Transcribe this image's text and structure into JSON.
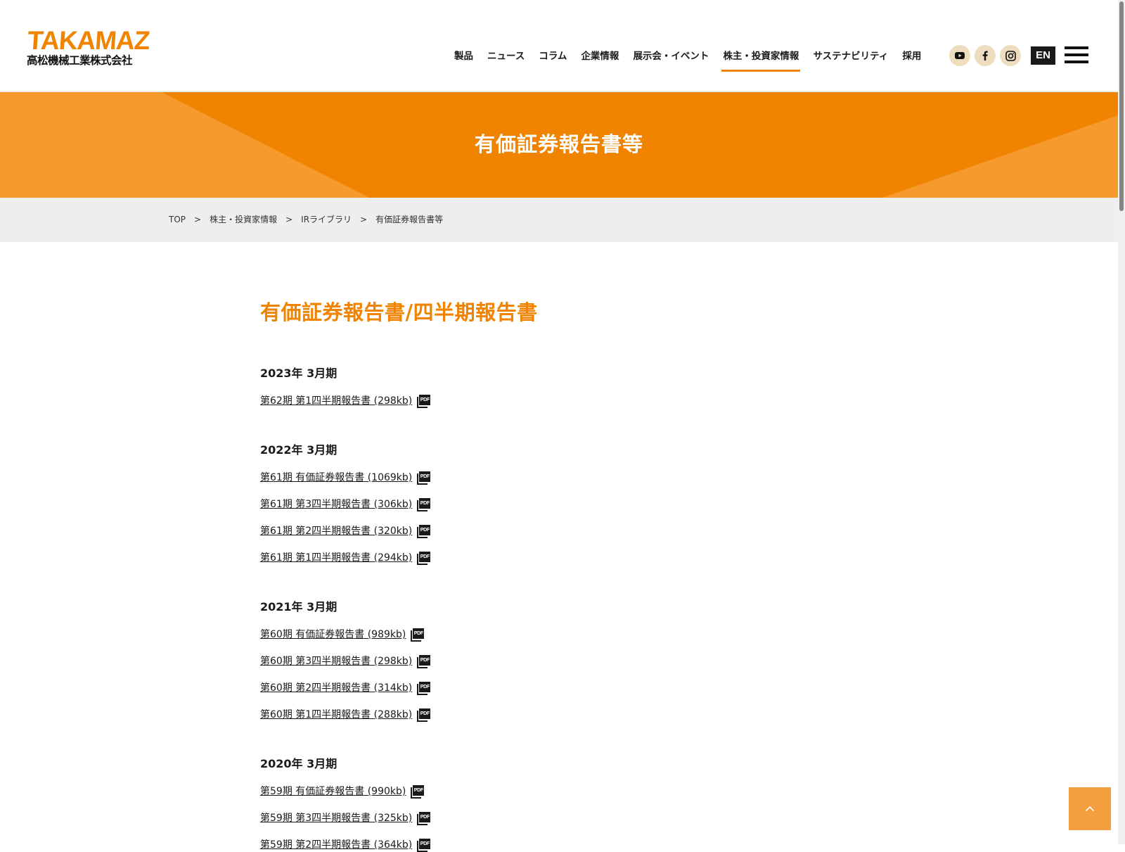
{
  "header": {
    "logo_text": "TAKAMAZ",
    "logo_sub": "高松機械工業株式会社",
    "nav": [
      {
        "label": "製品",
        "active": false
      },
      {
        "label": "ニュース",
        "active": false
      },
      {
        "label": "コラム",
        "active": false
      },
      {
        "label": "企業情報",
        "active": false
      },
      {
        "label": "展示会・イベント",
        "active": false
      },
      {
        "label": "株主・投資家情報",
        "active": true
      },
      {
        "label": "サステナビリティ",
        "active": false
      },
      {
        "label": "採用",
        "active": false
      }
    ],
    "social_icons": [
      "youtube-icon",
      "facebook-icon",
      "instagram-icon"
    ],
    "lang_button": "EN"
  },
  "hero": {
    "title": "有価証券報告書等"
  },
  "breadcrumb": {
    "separator": ">",
    "items": [
      "TOP",
      "株主・投資家情報",
      "IRライブラリ",
      "有価証券報告書等"
    ]
  },
  "main": {
    "section_title": "有価証券報告書/四半期報告書",
    "pdf_badge": "PDF",
    "groups": [
      {
        "year": "2023年 3月期",
        "docs": [
          "第62期 第1四半期報告書 (298kb)"
        ]
      },
      {
        "year": "2022年 3月期",
        "docs": [
          "第61期 有価証券報告書 (1069kb)",
          "第61期 第3四半期報告書 (306kb)",
          "第61期 第2四半期報告書 (320kb)",
          "第61期 第1四半期報告書 (294kb)"
        ]
      },
      {
        "year": "2021年 3月期",
        "docs": [
          "第60期 有価証券報告書 (989kb)",
          "第60期 第3四半期報告書 (298kb)",
          "第60期 第2四半期報告書 (314kb)",
          "第60期 第1四半期報告書 (288kb)"
        ]
      },
      {
        "year": "2020年 3月期",
        "docs": [
          "第59期 有価証券報告書 (990kb)",
          "第59期 第3四半期報告書 (325kb)",
          "第59期 第2四半期報告書 (364kb)"
        ]
      }
    ]
  },
  "colors": {
    "accent": "#f08300",
    "hero_light": "#f69a2e",
    "social_bg": "#eddcbd",
    "breadcrumb_bg": "#eeeeee",
    "to_top_bg": "#f5a040"
  }
}
